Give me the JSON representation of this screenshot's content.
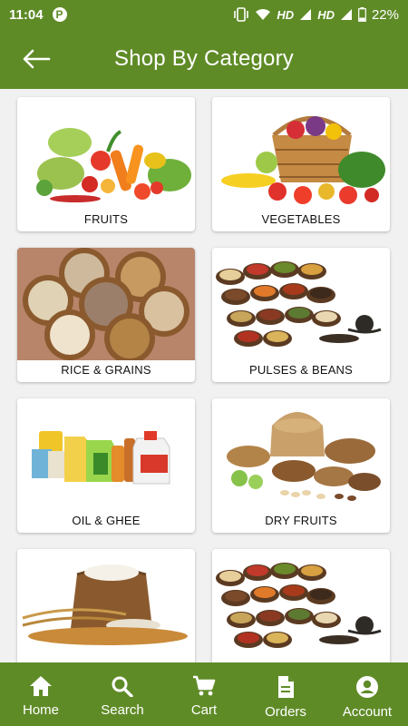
{
  "status_bar": {
    "time": "11:04",
    "network_1": "HD",
    "network_2": "HD",
    "battery": "22%"
  },
  "header": {
    "title": "Shop By Category",
    "back_icon": "arrow-left-icon"
  },
  "categories": [
    {
      "label": "FRUITS",
      "image": "fruits-image"
    },
    {
      "label": "VEGETABLES",
      "image": "vegetables-image"
    },
    {
      "label": "RICE & GRAINS",
      "image": "grains-bowls-image"
    },
    {
      "label": "PULSES & BEANS",
      "image": "spices-pulses-image"
    },
    {
      "label": "OIL & GHEE",
      "image": "oil-bottles-image"
    },
    {
      "label": "DRY FRUITS",
      "image": "dry-fruits-image"
    },
    {
      "label": "",
      "image": "flour-wheat-image"
    },
    {
      "label": "",
      "image": "spices-image"
    }
  ],
  "bottom_nav": [
    {
      "label": "Home",
      "icon": "home-icon"
    },
    {
      "label": "Search",
      "icon": "search-icon"
    },
    {
      "label": "Cart",
      "icon": "cart-icon"
    },
    {
      "label": "Orders",
      "icon": "orders-icon"
    },
    {
      "label": "Account",
      "icon": "account-icon"
    }
  ],
  "colors": {
    "brand": "#5f8b27",
    "background": "#f1f1f1"
  }
}
